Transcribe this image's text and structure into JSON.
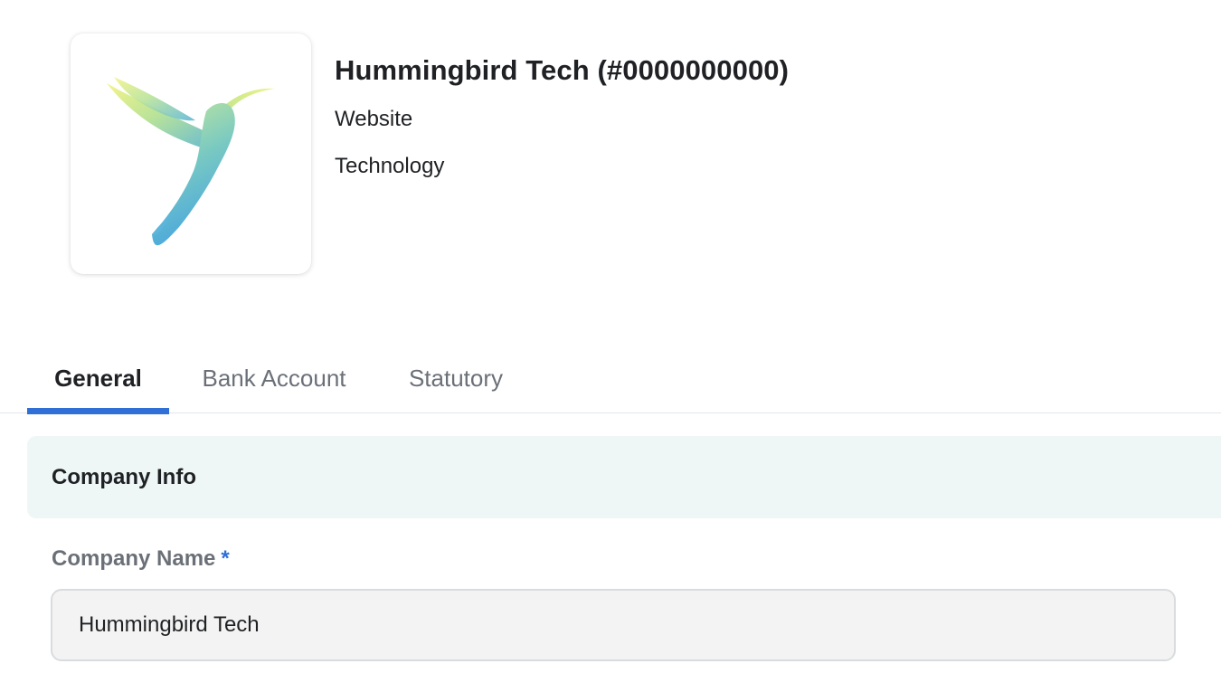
{
  "company": {
    "title": "Hummingbird Tech (#0000000000)",
    "website": "Website",
    "industry": "Technology",
    "logo_icon": "hummingbird-logo"
  },
  "tabs": [
    {
      "label": "General",
      "active": true
    },
    {
      "label": "Bank Account",
      "active": false
    },
    {
      "label": "Statutory",
      "active": false
    }
  ],
  "section": {
    "title": "Company Info"
  },
  "fields": {
    "company_name": {
      "label": "Company Name",
      "required_mark": "*",
      "value": "Hummingbird Tech"
    }
  },
  "colors": {
    "accent": "#2f6fd6",
    "section_bg": "#eff7f6",
    "input_bg": "#f3f3f3",
    "muted_text": "#6b7078"
  }
}
